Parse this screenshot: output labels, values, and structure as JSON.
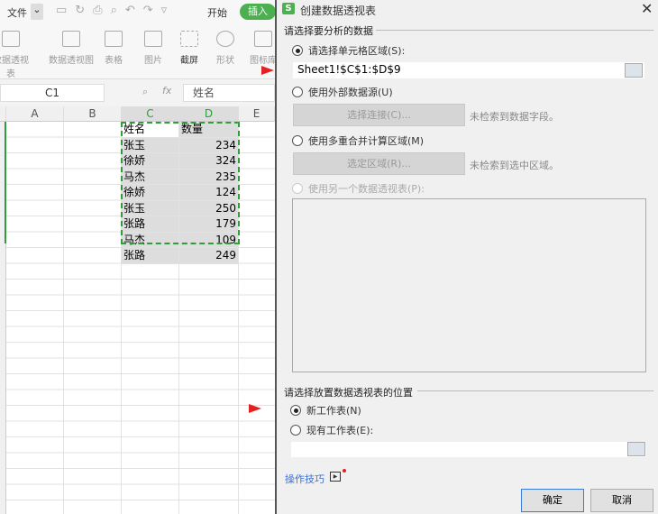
{
  "toolbar": {
    "file": "文件",
    "start": "开始",
    "insert": "插入",
    "ribbon": [
      "数据透视表",
      "数据透视图",
      "表格",
      "图片",
      "截屏",
      "形状",
      "图标库"
    ]
  },
  "formula": {
    "cell_ref": "C1",
    "fx": "fx",
    "value": "姓名"
  },
  "columns": [
    "A",
    "B",
    "C",
    "D",
    "E"
  ],
  "table": {
    "headers": [
      "姓名",
      "数量"
    ],
    "rows": [
      [
        "张玉",
        "234"
      ],
      [
        "徐娇",
        "324"
      ],
      [
        "马杰",
        "235"
      ],
      [
        "徐娇",
        "124"
      ],
      [
        "张玉",
        "250"
      ],
      [
        "张路",
        "179"
      ],
      [
        "马杰",
        "109"
      ],
      [
        "张路",
        "249"
      ]
    ]
  },
  "dialog": {
    "title": "创建数据透视表",
    "section1": "请选择要分析的数据",
    "opt_range": "请选择单元格区域(S):",
    "range_value": "Sheet1!$C$1:$D$9",
    "opt_external": "使用外部数据源(U)",
    "btn_connect": "选择连接(C)...",
    "note_connect": "未检索到数据字段。",
    "opt_multi": "使用多重合并计算区域(M)",
    "btn_select": "选定区域(R)...",
    "note_select": "未检索到选中区域。",
    "opt_other": "使用另一个数据透视表(P):",
    "section2": "请选择放置数据透视表的位置",
    "opt_new": "新工作表(N)",
    "opt_existing": "现有工作表(E):",
    "existing_value": "",
    "tips": "操作技巧",
    "ok": "确定",
    "cancel": "取消"
  },
  "colors": {
    "accent": "#4caf50",
    "selection": "#2e9e3a",
    "arrow": "#e62020",
    "link": "#3b6fd8"
  }
}
